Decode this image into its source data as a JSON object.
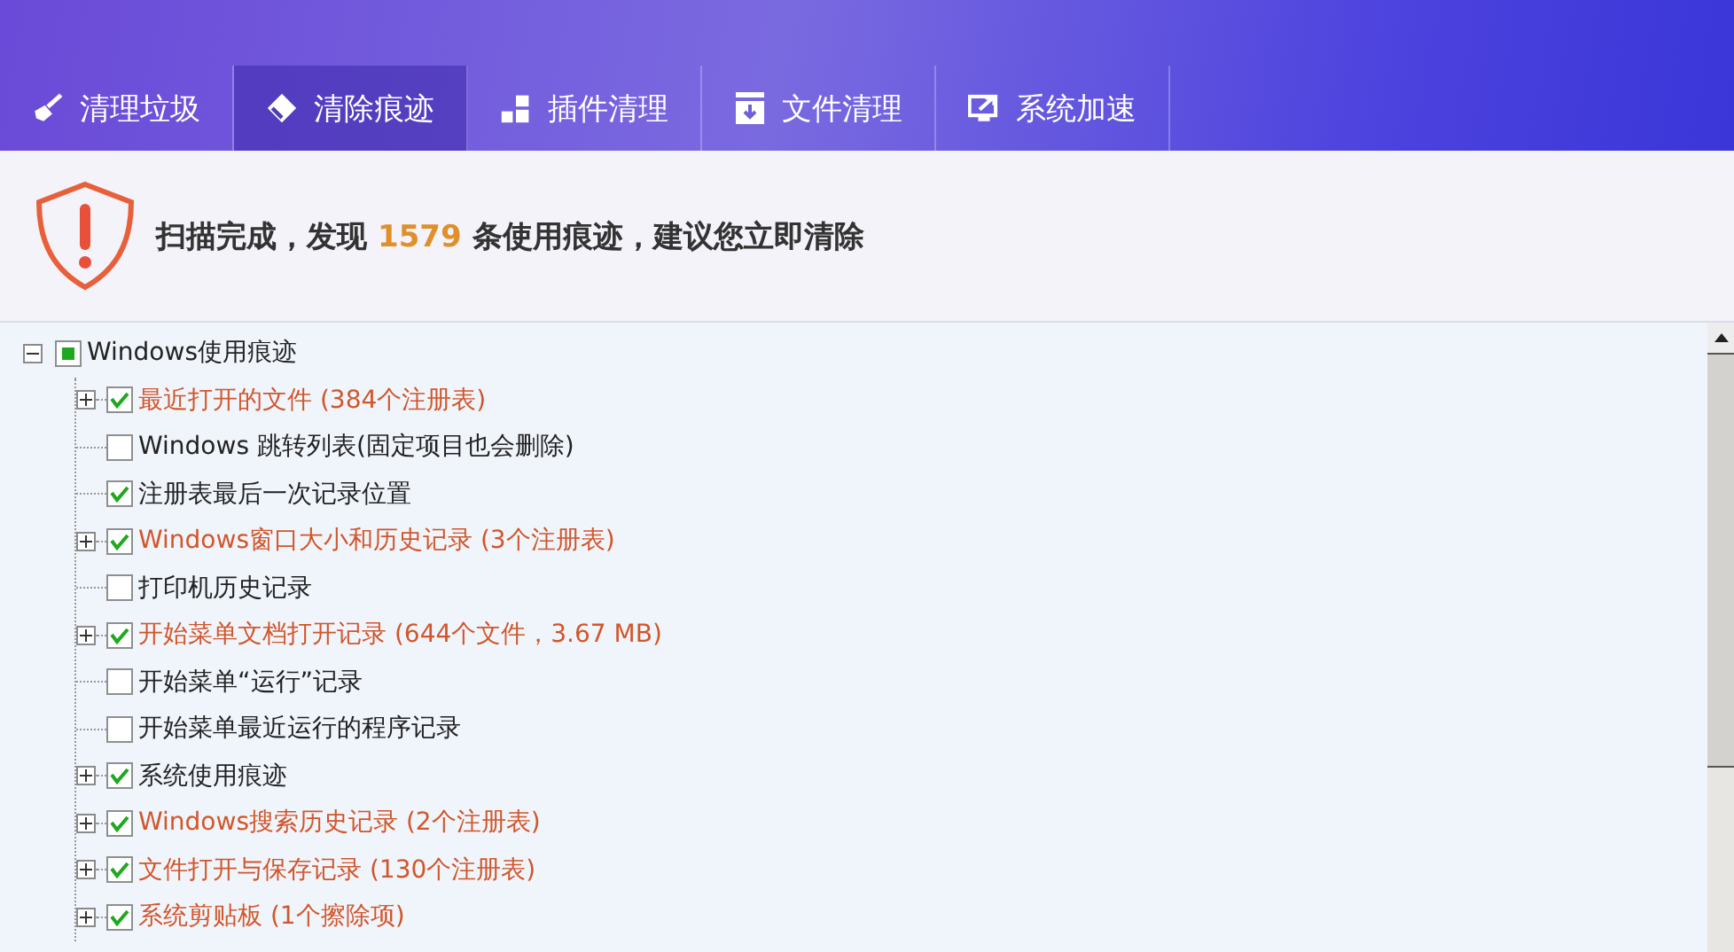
{
  "tabs": [
    {
      "label": "清理垃圾",
      "selected": false
    },
    {
      "label": "清除痕迹",
      "selected": true
    },
    {
      "label": "插件清理",
      "selected": false
    },
    {
      "label": "文件清理",
      "selected": false
    },
    {
      "label": "系统加速",
      "selected": false
    }
  ],
  "scan_result": {
    "text_before": "扫描完成，发现",
    "count": "1579",
    "text_after": "条使用痕迹，建议您立即清除"
  },
  "tree": [
    {
      "label": "Windows使用痕迹",
      "checked": true,
      "partial": true,
      "expanded": true,
      "highlighted": false,
      "children": [
        {
          "label": "最近打开的文件 (384个注册表)",
          "checked": true,
          "expanded": false,
          "highlighted": true
        },
        {
          "label": "Windows 跳转列表(固定项目也会删除)",
          "checked": false,
          "highlighted": false
        },
        {
          "label": "注册表最后一次记录位置",
          "checked": true,
          "highlighted": false
        },
        {
          "label": "Windows窗口大小和历史记录 (3个注册表)",
          "checked": true,
          "expanded": false,
          "highlighted": true
        },
        {
          "label": "打印机历史记录",
          "checked": false,
          "highlighted": false
        },
        {
          "label": "开始菜单文档打开记录 (644个文件，3.67 MB)",
          "checked": true,
          "expanded": false,
          "highlighted": true
        },
        {
          "label": "开始菜单“运行”记录",
          "checked": false,
          "highlighted": false
        },
        {
          "label": "开始菜单最近运行的程序记录",
          "checked": false,
          "highlighted": false
        },
        {
          "label": "系统使用痕迹",
          "checked": true,
          "expanded": false,
          "highlighted": false
        },
        {
          "label": "Windows搜索历史记录 (2个注册表)",
          "checked": true,
          "expanded": false,
          "highlighted": true
        },
        {
          "label": "文件打开与保存记录 (130个注册表)",
          "checked": true,
          "expanded": false,
          "highlighted": true
        },
        {
          "label": "系统剪贴板 (1个擦除项)",
          "checked": true,
          "expanded": false,
          "highlighted": true
        }
      ]
    }
  ]
}
